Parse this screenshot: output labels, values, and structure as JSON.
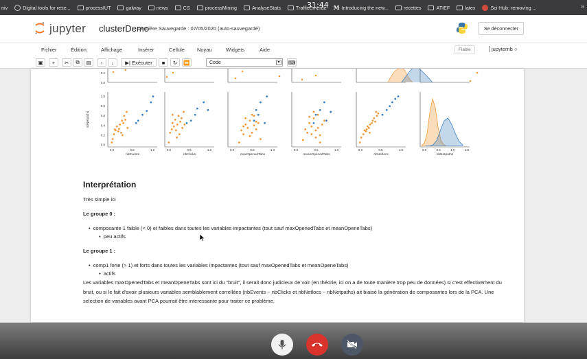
{
  "bookmarks": {
    "items": [
      "niv",
      "Digital tools for rese...",
      "processIUT",
      "galway",
      "news",
      "CS",
      "processMining",
      "AnalyseStats",
      "TrafficEmerde",
      "Introducing the new...",
      "recettes",
      "ATIEF",
      "latex",
      "Sci-Hub: removing ..."
    ],
    "clock": "31:44",
    "more": "»"
  },
  "header": {
    "brand": "jupyter",
    "notebook_name": "clusterDemo",
    "save_status": "Dernière Sauvegarde : 07/05/2020  (auto-sauvegardé)",
    "logout": "Se déconnecter"
  },
  "menubar": {
    "items": [
      "Fichier",
      "Édition",
      "Affichage",
      "Insérer",
      "Cellule",
      "Noyau",
      "Widgets",
      "Aide"
    ],
    "trusted": "Fiable",
    "kernel": "jupyternb"
  },
  "toolbar": {
    "run_label": "Exécuter",
    "cell_type": "Code"
  },
  "markdown": {
    "title": "Interprétation",
    "intro": "Très simple ici",
    "group0_title": "Le groupe 0 :",
    "group0_bullet": "composante 1 faible (< 0) et faibles dans toutes les variables impactantes (tout sauf maxOpenedTabs et meanOpeneTabs)",
    "group0_sub": "peu actifs",
    "group1_title": "Le groupe 1 :",
    "group1_bullet": "comp1 forte (> 1) et forts dans toutes les variables impactantes (tout sauf maxOpenedTabs et meanOpeneTabs)",
    "group1_sub": "actifs",
    "paragraph": "Les variables maxOpenedTabs et meanOpeneTabs sont ici du \"bruit\", il serait donc judicieux de voir (en théorie, ici on a de toute manière trop peu de données) si c'est effectivement du bruit, ou si le fait d'avoir plusieurs variables semblablement correllées (nbEvents ~ nbClicks et nbNetlocs ~ nbNetpaths) ait biaisé la génération de composantes lors de la PCA. Une selection de variables avant PCA pourrait être interessante pour traiter ce problème."
  },
  "colors": {
    "orange": "#f39a3b",
    "blue": "#3a7fc1",
    "hangup": "#d8332c"
  },
  "chart_data": {
    "type": "scatter",
    "title": "",
    "ylabel": "nbNetpaths",
    "panels_xlabels": [
      "nbEvents",
      "nbClicks",
      "maxOpenedTabs",
      "meanOpenedTabs",
      "nbNetlocs",
      "nbNetpaths"
    ],
    "xticks": [
      [
        "0.0",
        "0.5",
        "1.0"
      ],
      [
        "0.0",
        "0.5",
        "1.0"
      ],
      [
        "0.0",
        "0.5",
        "1.0"
      ],
      [
        "0.0",
        "0.5",
        "1.0"
      ],
      [
        "0.0",
        "0.5",
        "1.0"
      ],
      [
        "0.0",
        "0.5",
        "1.0",
        "1.5"
      ]
    ],
    "yticks": [
      "0.0",
      "0.2",
      "0.4",
      "0.6",
      "0.8",
      "1.0"
    ],
    "top_row_yticks": [
      "0.0",
      "0.2"
    ],
    "ylim": [
      0,
      1.05
    ],
    "series": [
      {
        "cluster": 0,
        "color": "#f39a3b",
        "points": [
          [
            [
              0.03,
              0.05
            ],
            [
              0.05,
              0.12
            ],
            [
              0.08,
              0.22
            ],
            [
              0.12,
              0.3
            ],
            [
              0.15,
              0.38
            ],
            [
              0.18,
              0.28
            ],
            [
              0.2,
              0.33
            ],
            [
              0.22,
              0.42
            ],
            [
              0.25,
              0.25
            ],
            [
              0.27,
              0.5
            ],
            [
              0.3,
              0.45
            ],
            [
              0.32,
              0.6
            ],
            [
              0.35,
              0.52
            ],
            [
              0.38,
              0.68
            ],
            [
              0.4,
              0.35
            ],
            [
              0.28,
              0.2
            ],
            [
              0.1,
              0.32
            ]
          ],
          [
            [
              0.03,
              0.05
            ],
            [
              0.06,
              0.25
            ],
            [
              0.1,
              0.32
            ],
            [
              0.12,
              0.45
            ],
            [
              0.15,
              0.38
            ],
            [
              0.18,
              0.52
            ],
            [
              0.2,
              0.3
            ],
            [
              0.23,
              0.42
            ],
            [
              0.26,
              0.6
            ],
            [
              0.28,
              0.22
            ],
            [
              0.3,
              0.48
            ],
            [
              0.33,
              0.55
            ],
            [
              0.35,
              0.35
            ],
            [
              0.38,
              0.68
            ],
            [
              0.22,
              0.15
            ],
            [
              0.12,
              0.62
            ],
            [
              0.4,
              0.42
            ]
          ],
          [
            [
              0.2,
              0.05
            ],
            [
              0.25,
              0.3
            ],
            [
              0.3,
              0.22
            ],
            [
              0.35,
              0.42
            ],
            [
              0.4,
              0.35
            ],
            [
              0.45,
              0.5
            ],
            [
              0.5,
              0.25
            ],
            [
              0.55,
              0.6
            ],
            [
              0.6,
              0.32
            ],
            [
              0.65,
              0.45
            ],
            [
              0.7,
              0.12
            ],
            [
              0.5,
              0.62
            ],
            [
              0.45,
              0.18
            ],
            [
              0.55,
              0.4
            ],
            [
              0.35,
              0.55
            ],
            [
              0.6,
              0.48
            ],
            [
              0.3,
              0.38
            ]
          ],
          [
            [
              0.2,
              0.1
            ],
            [
              0.25,
              0.32
            ],
            [
              0.3,
              0.25
            ],
            [
              0.35,
              0.45
            ],
            [
              0.4,
              0.38
            ],
            [
              0.45,
              0.55
            ],
            [
              0.5,
              0.3
            ],
            [
              0.55,
              0.62
            ],
            [
              0.6,
              0.2
            ],
            [
              0.65,
              0.42
            ],
            [
              0.7,
              0.5
            ],
            [
              0.5,
              0.15
            ],
            [
              0.45,
              0.68
            ],
            [
              0.55,
              0.35
            ],
            [
              0.35,
              0.58
            ],
            [
              0.6,
              0.05
            ],
            [
              0.4,
              0.22
            ]
          ],
          [
            [
              0.02,
              0.05
            ],
            [
              0.05,
              0.15
            ],
            [
              0.1,
              0.22
            ],
            [
              0.13,
              0.3
            ],
            [
              0.16,
              0.28
            ],
            [
              0.2,
              0.38
            ],
            [
              0.23,
              0.35
            ],
            [
              0.26,
              0.42
            ],
            [
              0.3,
              0.45
            ],
            [
              0.32,
              0.5
            ],
            [
              0.35,
              0.55
            ],
            [
              0.38,
              0.48
            ],
            [
              0.42,
              0.6
            ],
            [
              0.45,
              0.65
            ],
            [
              0.25,
              0.25
            ],
            [
              0.18,
              0.32
            ],
            [
              0.4,
              0.68
            ]
          ]
        ],
        "kde": [
          0.0,
          0.05,
          0.25,
          0.7,
          1.0,
          0.82,
          0.4,
          0.12,
          0.02,
          0.0
        ]
      },
      {
        "cluster": 1,
        "color": "#3a7fc1",
        "points": [
          [
            [
              0.6,
              0.45
            ],
            [
              0.65,
              0.5
            ],
            [
              0.75,
              0.62
            ],
            [
              0.85,
              0.7
            ],
            [
              0.95,
              0.88
            ],
            [
              1.0,
              1.0
            ]
          ],
          [
            [
              0.45,
              0.45
            ],
            [
              0.55,
              0.5
            ],
            [
              0.65,
              0.62
            ],
            [
              0.7,
              0.75
            ],
            [
              0.85,
              0.88
            ],
            [
              0.95,
              0.72
            ]
          ],
          [
            [
              0.55,
              0.5
            ],
            [
              0.6,
              0.72
            ],
            [
              0.65,
              0.62
            ],
            [
              0.7,
              0.88
            ],
            [
              0.8,
              0.45
            ],
            [
              0.85,
              1.0
            ]
          ],
          [
            [
              0.45,
              0.45
            ],
            [
              0.5,
              0.62
            ],
            [
              0.6,
              0.72
            ],
            [
              0.7,
              0.88
            ],
            [
              0.75,
              0.5
            ],
            [
              0.85,
              0.68
            ]
          ],
          [
            [
              0.55,
              0.62
            ],
            [
              0.65,
              0.72
            ],
            [
              0.72,
              0.8
            ],
            [
              0.78,
              0.88
            ],
            [
              0.85,
              0.95
            ],
            [
              0.92,
              1.0
            ]
          ]
        ],
        "kde": [
          0.0,
          0.0,
          0.02,
          0.15,
          0.45,
          0.72,
          0.8,
          0.62,
          0.35,
          0.12,
          0.02
        ]
      }
    ]
  }
}
